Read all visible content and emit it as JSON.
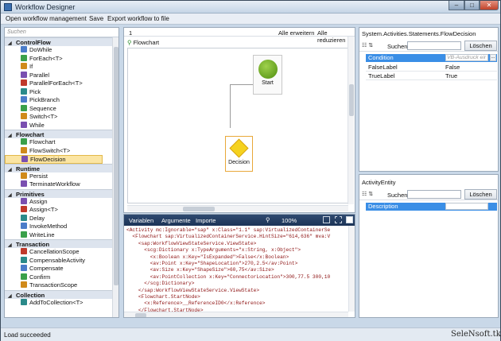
{
  "window": {
    "title": "Workflow Designer",
    "min": "–",
    "max": "□",
    "close": "✕"
  },
  "menu": {
    "items": [
      "Open workflow management",
      "Save",
      "Export workflow to file"
    ]
  },
  "toolbox": {
    "search_placeholder": "Suchen",
    "categories": [
      {
        "name": "ControlFlow",
        "items": [
          "DoWhile",
          "ForEach<T>",
          "If",
          "Parallel",
          "ParallelForEach<T>",
          "Pick",
          "PickBranch",
          "Sequence",
          "Switch<T>",
          "While"
        ]
      },
      {
        "name": "Flowchart",
        "items": [
          "Flowchart",
          "FlowSwitch<T>",
          "FlowDecision"
        ]
      },
      {
        "name": "Runtime",
        "items": [
          "Persist",
          "TerminateWorkflow"
        ]
      },
      {
        "name": "Primitives",
        "items": [
          "Assign",
          "Assign<T>",
          "Delay",
          "InvokeMethod",
          "WriteLine"
        ]
      },
      {
        "name": "Transaction",
        "items": [
          "CancellationScope",
          "CompensableActivity",
          "Compensate",
          "Confirm",
          "TransactionScope"
        ]
      },
      {
        "name": "Collection",
        "items": [
          "AddToCollection<T>"
        ]
      }
    ],
    "selected": "FlowDecision"
  },
  "designer": {
    "breadcrumb": "1",
    "expand_all": "Alle erweitern",
    "collapse_all": "Alle reduzieren",
    "root_label": "Flowchart",
    "start_label": "Start",
    "decision_label": "Decision"
  },
  "xaml": {
    "tabs": [
      "Variablen",
      "Argumente",
      "Importe"
    ],
    "zoom": "100%",
    "lines": [
      "<Activity mc:Ignorable=\"sap\" x:Class=\"1.1\" sap:VirtualizedContainerSe",
      "  <Flowchart sap:VirtualizedContainerService.HintSize=\"614,636\" mva:V",
      "    <sap:WorkflowViewStateService.ViewState>",
      "      <scg:Dictionary x:TypeArguments=\"x:String, x:Object\">",
      "        <x:Boolean x:Key=\"IsExpanded\">False</x:Boolean>",
      "        <av:Point x:Key=\"ShapeLocation\">270,2.5</av:Point>",
      "        <av:Size x:Key=\"ShapeSize\">60,75</av:Size>",
      "        <av:PointCollection x:Key=\"ConnectorLocation\">300,77.5 300,10",
      "      </scg:Dictionary>",
      "    </sap:WorkflowViewStateService.ViewState>",
      "    <Flowchart.StartNode>",
      "      <x:Reference>__ReferenceID0</x:Reference>",
      "    </Flowchart.StartNode>"
    ]
  },
  "properties": {
    "header": "System.Activities.Statements.FlowDecision",
    "search_label": "Suchen:",
    "clear_button": "Löschen",
    "rows": [
      {
        "key": "Condition",
        "value": "VB-Ausdruck eir",
        "more": "..."
      },
      {
        "key": "FalseLabel",
        "value": "False"
      },
      {
        "key": "TrueLabel",
        "value": "True"
      }
    ]
  },
  "entity": {
    "header": "ActivityEntity",
    "search_label": "Suchen:",
    "clear_button": "Löschen",
    "rows": [
      {
        "key": "Description",
        "value": ""
      }
    ]
  },
  "status": {
    "text": "Load succeeded",
    "brand": "SeleNsoft.tk"
  },
  "colors": {
    "accent": "#3a8ee6",
    "start": "#6fb023",
    "decision": "#f5d21f",
    "selection": "#fbe5a3"
  }
}
